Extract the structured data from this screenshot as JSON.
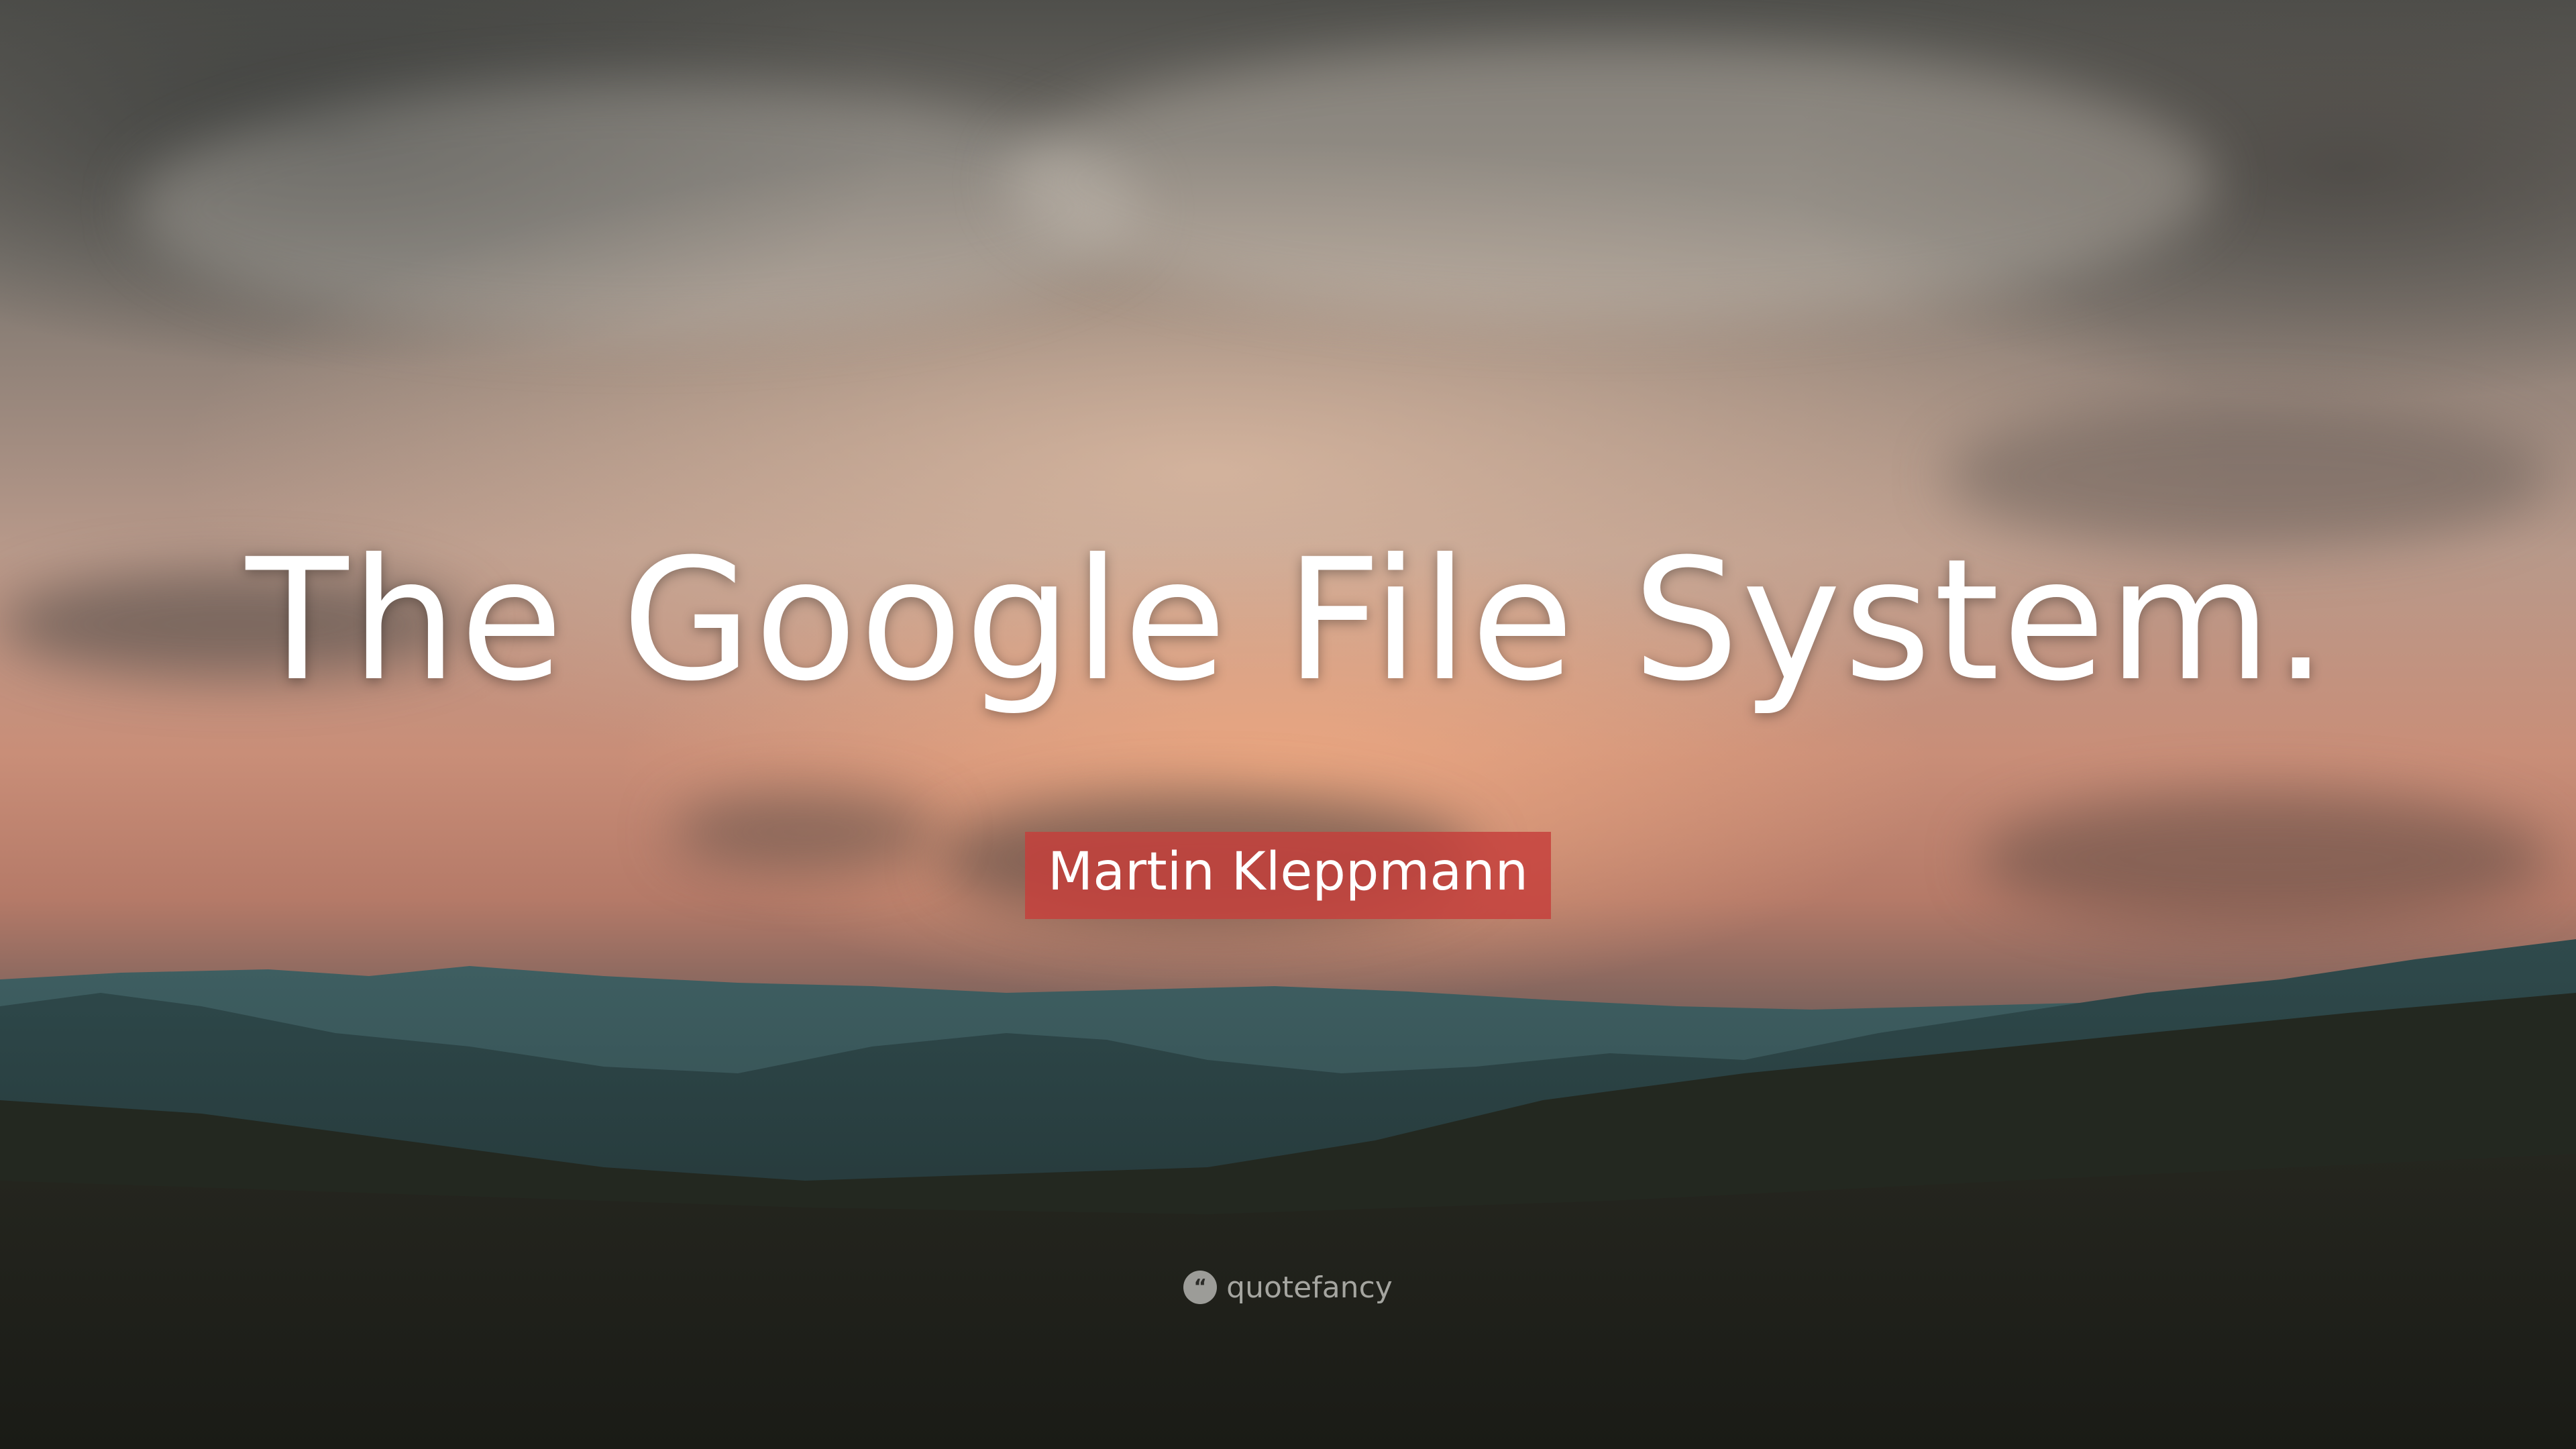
{
  "quote": {
    "text": "The Google File System."
  },
  "author": {
    "name": "Martin Kleppmann",
    "badge_color": "#c63e3a"
  },
  "brand": {
    "name": "quotefancy",
    "icon": "quote-marks-icon",
    "icon_glyph": "“"
  },
  "colors": {
    "sky_glow": "#c98e78",
    "mountain_teal": "#2f4a4c",
    "ground": "#1d1e19"
  }
}
